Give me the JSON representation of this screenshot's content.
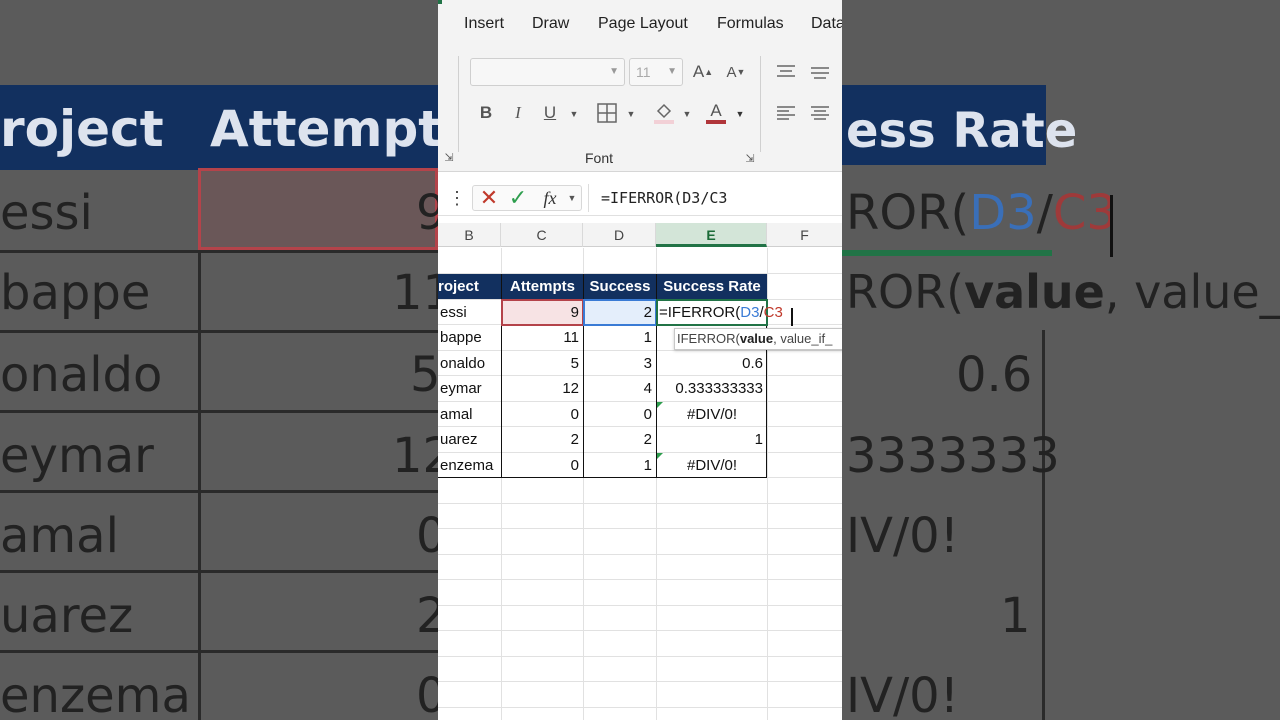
{
  "background_zoom": {
    "headers": [
      "roject",
      "Attempts",
      "ess Rate"
    ],
    "left_names": [
      "essi",
      "bappe",
      "onaldo",
      "eymar",
      "amal",
      "uarez",
      "enzema"
    ],
    "mid_values": [
      "9",
      "11",
      "5",
      "12",
      "0",
      "2",
      "0"
    ],
    "right_values": [
      "ROR(D3/C3",
      "ROR(value, value_if_",
      "0.6",
      "3333333",
      "IV/0!",
      "1",
      "IV/0!"
    ],
    "right_formula_ref1": "D3",
    "right_formula_sep": "/",
    "right_formula_ref2": "C3",
    "right_formula_prefix": "ROR(",
    "right_tip_prefix": "ROR(",
    "right_tip_bold": "value",
    "right_tip_rest": ", value_if_"
  },
  "ribbon": {
    "tabs": [
      "Insert",
      "Draw",
      "Page Layout",
      "Formulas",
      "Data"
    ],
    "font_size": "11",
    "group_label": "Font",
    "bold": "B",
    "italic": "I",
    "underline": "U",
    "grow_font": "A",
    "shrink_font": "A",
    "font_color_letter": "A"
  },
  "formula_bar": {
    "fx": "fx",
    "formula": "=IFERROR(D3/C3"
  },
  "columns": [
    "B",
    "C",
    "D",
    "E",
    "F"
  ],
  "table": {
    "headers": [
      "roject",
      "Attempts",
      "Success",
      "Success Rate"
    ],
    "rows": [
      {
        "name": "essi",
        "attempts": "9",
        "success": "2",
        "rate": ""
      },
      {
        "name": "bappe",
        "attempts": "11",
        "success": "1",
        "rate": ""
      },
      {
        "name": "onaldo",
        "attempts": "5",
        "success": "3",
        "rate": "0.6"
      },
      {
        "name": "eymar",
        "attempts": "12",
        "success": "4",
        "rate": "0.333333333"
      },
      {
        "name": "amal",
        "attempts": "0",
        "success": "0",
        "rate": "#DIV/0!"
      },
      {
        "name": "uarez",
        "attempts": "2",
        "success": "2",
        "rate": "1"
      },
      {
        "name": "enzema",
        "attempts": "0",
        "success": "1",
        "rate": "#DIV/0!"
      }
    ]
  },
  "edit_cell": {
    "prefix": "=IFERROR(",
    "ref1": "D3",
    "sep": "/",
    "ref2": "C3"
  },
  "tooltip": {
    "prefix": "IFERROR(",
    "bold": "value",
    "rest": ", value_if_"
  },
  "colors": {
    "header_fill": "#12305f",
    "ref1_color": "#3a7bd5",
    "ref2_color": "#c0392b",
    "active_green": "#217346"
  }
}
